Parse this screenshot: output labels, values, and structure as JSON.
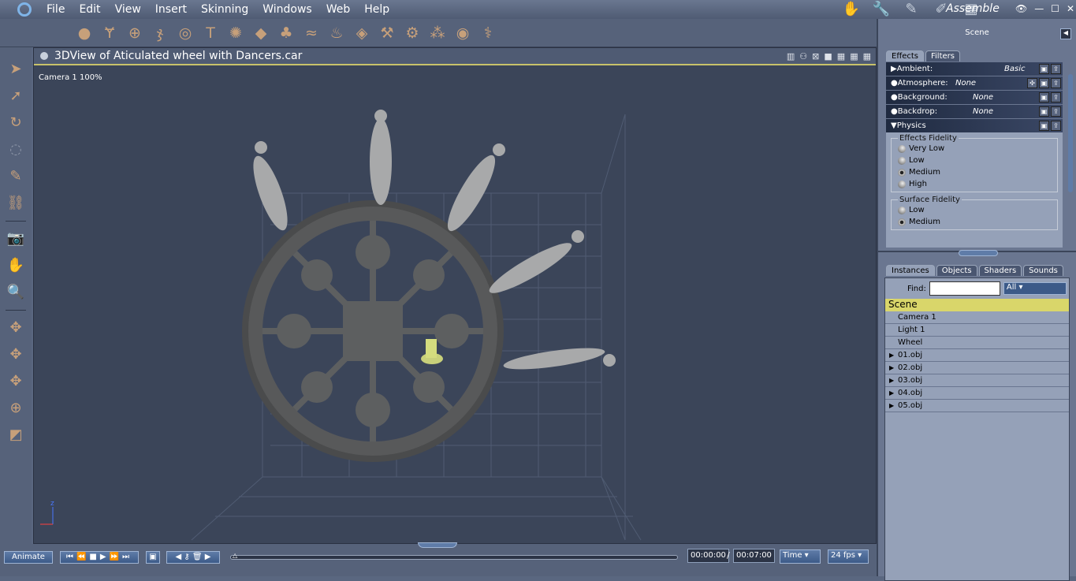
{
  "menu": {
    "items": [
      "File",
      "Edit",
      "View",
      "Insert",
      "Skinning",
      "Windows",
      "Web",
      "Help"
    ],
    "room": "Assemble"
  },
  "toolbar": {
    "icons": [
      "sphere-icon",
      "goblet-icon",
      "globe-icon",
      "bones-icon",
      "torus-icon",
      "text-icon",
      "gear-ball-icon",
      "landscape-icon",
      "tree-icon",
      "fog-icon",
      "fire-icon",
      "box-icon",
      "torch-icon",
      "camera-icon",
      "bone-tree-icon",
      "ring-icon",
      "bone-icon"
    ]
  },
  "viewport": {
    "title": "3DView of Aticulated wheel with Dancers.car",
    "camera_label": "Camera 1 100%"
  },
  "right": {
    "header": "Scene",
    "effect_tabs": [
      "Effects",
      "Filters"
    ],
    "effects": [
      {
        "label": "Ambient:",
        "value": "Basic"
      },
      {
        "label": "Atmosphere:",
        "value": "None"
      },
      {
        "label": "Background:",
        "value": "None"
      },
      {
        "label": "Backdrop:",
        "value": "None"
      },
      {
        "label": "Physics",
        "value": ""
      }
    ],
    "effects_fidelity": {
      "title": "Effects Fidelity",
      "options": [
        "Very Low",
        "Low",
        "Medium",
        "High"
      ],
      "selected": "Medium"
    },
    "surface_fidelity": {
      "title": "Surface Fidelity",
      "options": [
        "Low",
        "Medium"
      ],
      "selected": "Medium"
    },
    "inst_tabs": [
      "Instances",
      "Objects",
      "Shaders",
      "Sounds"
    ],
    "find_label": "Find:",
    "find_value": "",
    "find_filter": "All",
    "scene_label": "Scene",
    "items": [
      {
        "label": "Camera 1"
      },
      {
        "label": "Light 1"
      },
      {
        "label": "Wheel"
      },
      {
        "label": "01.obj",
        "expandable": true
      },
      {
        "label": "02.obj",
        "expandable": true
      },
      {
        "label": "03.obj",
        "expandable": true
      },
      {
        "label": "04.obj",
        "expandable": true
      },
      {
        "label": "05.obj",
        "expandable": true
      }
    ]
  },
  "timeline": {
    "animate": "Animate",
    "current": "00:00:00",
    "sep": "/",
    "total": "00:07:00",
    "mode": "Time",
    "fps": "24 fps",
    "progress": 0
  }
}
